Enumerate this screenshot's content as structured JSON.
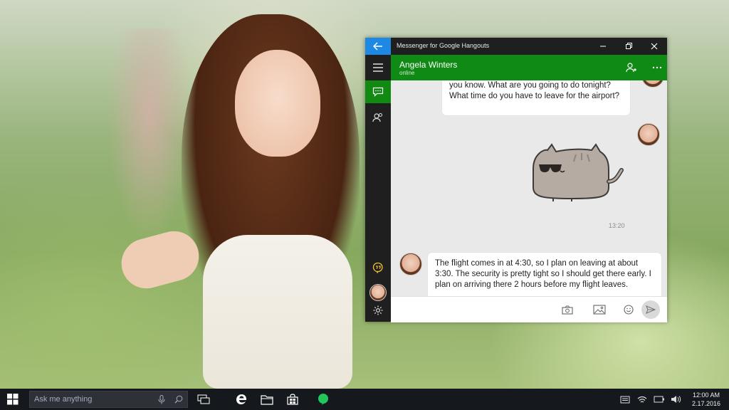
{
  "window": {
    "app_title": "Messenger for Google Hangouts"
  },
  "chat": {
    "contact_name": "Angela Winters",
    "contact_status": "online",
    "messages": [
      {
        "text": "you know. What are you going to do tonight? What time do you have to leave for the airport?"
      },
      {
        "sticker": "pusheen-cat-sunglasses"
      },
      {
        "text": "The flight comes in at 4:30, so I plan on leaving at about 3:30. The security is pretty tight so I should get there early.  I plan on arriving there 2 hours before my flight leaves."
      }
    ],
    "timestamp": "13:20"
  },
  "taskbar": {
    "search_placeholder": "Ask me anything",
    "time": "12:00 AM",
    "date": "2.17.2016"
  },
  "colors": {
    "accent_blue": "#1e88e5",
    "header_green": "#0f8a14",
    "taskbar_bg": "#15181d"
  },
  "icons": {
    "sidebar": [
      "hamburger-icon",
      "chat-icon",
      "contacts-icon",
      "hangouts-logo-icon",
      "avatar",
      "gear-icon"
    ],
    "composer": [
      "camera-icon",
      "image-icon",
      "emoji-icon",
      "send-icon"
    ],
    "tray": [
      "notification-icon",
      "wifi-icon",
      "battery-icon",
      "volume-icon"
    ]
  }
}
